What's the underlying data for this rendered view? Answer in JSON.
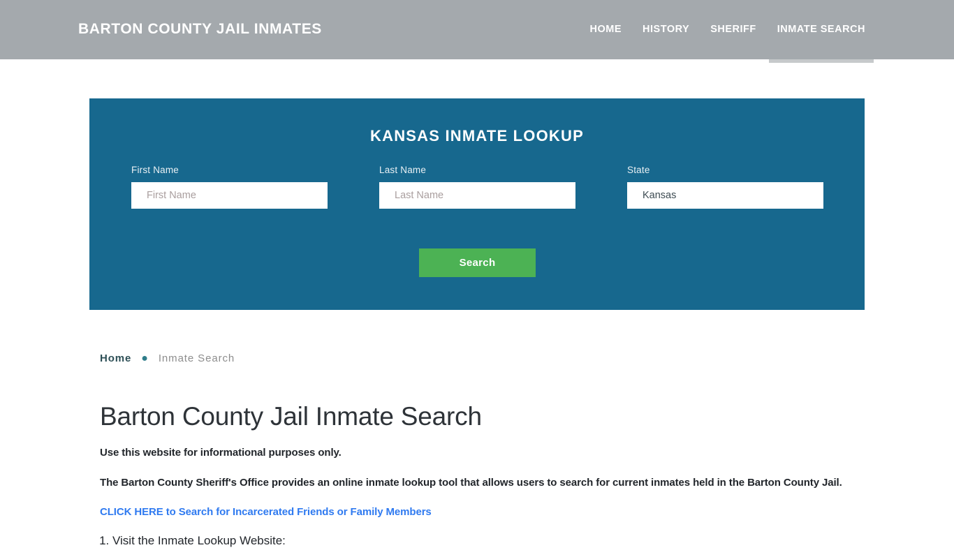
{
  "header": {
    "brand": "BARTON COUNTY JAIL INMATES",
    "nav": [
      {
        "label": "HOME",
        "active": false
      },
      {
        "label": "HISTORY",
        "active": false
      },
      {
        "label": "SHERIFF",
        "active": false
      },
      {
        "label": "INMATE SEARCH",
        "active": true
      }
    ]
  },
  "search_panel": {
    "title": "KANSAS INMATE LOOKUP",
    "fields": {
      "first_name": {
        "label": "First Name",
        "placeholder": "First Name",
        "value": ""
      },
      "last_name": {
        "label": "Last Name",
        "placeholder": "Last Name",
        "value": ""
      },
      "state": {
        "label": "State",
        "value": "Kansas",
        "options": [
          "Kansas"
        ]
      }
    },
    "submit_label": "Search",
    "colors": {
      "panel_background": "#17688e",
      "submit_background": "#4cb254"
    }
  },
  "breadcrumb": {
    "home": "Home",
    "separator": "●",
    "current": "Inmate Search"
  },
  "main": {
    "title": "Barton County Jail Inmate Search",
    "paragraph_1": "Use this website for informational purposes only.",
    "paragraph_2": "The Barton County Sheriff's Office provides an online inmate lookup tool that allows users to search for current inmates held in the Barton County Jail.",
    "cta_link": "CLICK HERE to Search for Incarcerated Friends or Family Members",
    "steps": [
      "Visit the Inmate Lookup Website:"
    ]
  }
}
